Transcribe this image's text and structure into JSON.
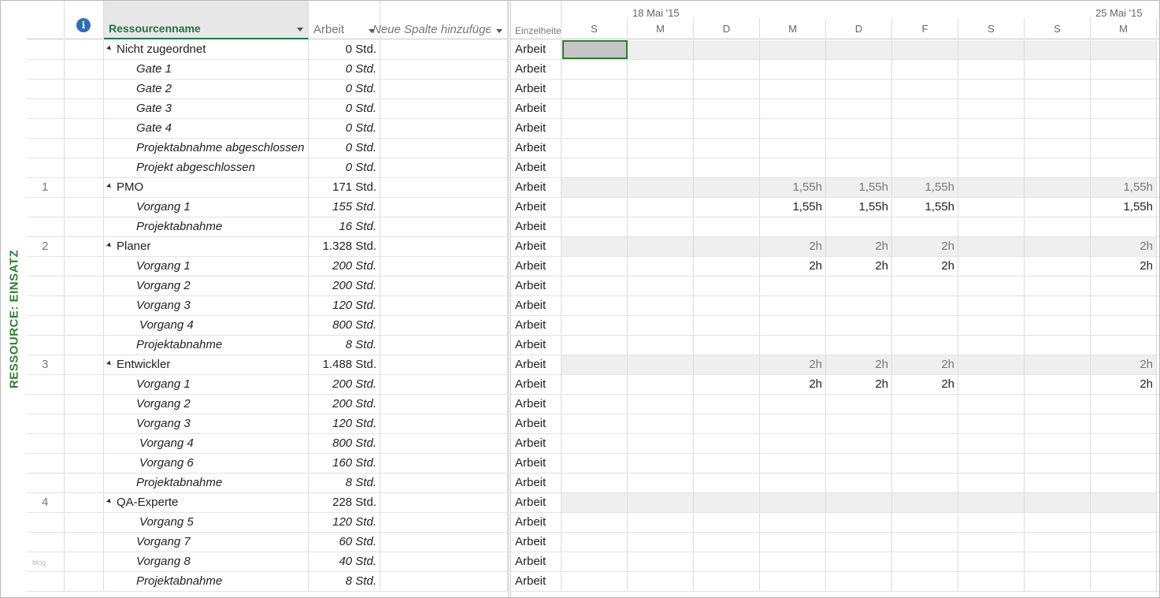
{
  "view_label": "RESSOURCE: EINSATZ",
  "columns": {
    "resource_name": "Ressourcenname",
    "work": "Arbeit",
    "add_column": "Neue Spalte hinzufügen",
    "details": "Einzelheiten"
  },
  "timescale": {
    "weeks": [
      {
        "label": "18 Mai '15"
      },
      {
        "label": "25 Mai '15"
      }
    ],
    "days": [
      "S",
      "M",
      "D",
      "M",
      "D",
      "F",
      "S",
      "S",
      "M"
    ]
  },
  "rows": [
    {
      "id": "",
      "name": "Nicht zugeordnet",
      "work": "0 Std.",
      "type": "parent",
      "detail": "Arbeit",
      "values": [
        "",
        "",
        "",
        "",
        "",
        "",
        "",
        "",
        ""
      ]
    },
    {
      "id": "",
      "name": "Gate 1",
      "work": "0 Std.",
      "type": "child",
      "detail": "Arbeit",
      "values": [
        "",
        "",
        "",
        "",
        "",
        "",
        "",
        "",
        ""
      ]
    },
    {
      "id": "",
      "name": "Gate 2",
      "work": "0 Std.",
      "type": "child",
      "detail": "Arbeit",
      "values": [
        "",
        "",
        "",
        "",
        "",
        "",
        "",
        "",
        ""
      ]
    },
    {
      "id": "",
      "name": "Gate 3",
      "work": "0 Std.",
      "type": "child",
      "detail": "Arbeit",
      "values": [
        "",
        "",
        "",
        "",
        "",
        "",
        "",
        "",
        ""
      ]
    },
    {
      "id": "",
      "name": "Gate 4",
      "work": "0 Std.",
      "type": "child",
      "detail": "Arbeit",
      "values": [
        "",
        "",
        "",
        "",
        "",
        "",
        "",
        "",
        ""
      ]
    },
    {
      "id": "",
      "name": "Projektabnahme abgeschlossen",
      "work": "0 Std.",
      "type": "child",
      "detail": "Arbeit",
      "values": [
        "",
        "",
        "",
        "",
        "",
        "",
        "",
        "",
        ""
      ]
    },
    {
      "id": "",
      "name": "Projekt abgeschlossen",
      "work": "0 Std.",
      "type": "child",
      "detail": "Arbeit",
      "values": [
        "",
        "",
        "",
        "",
        "",
        "",
        "",
        "",
        ""
      ]
    },
    {
      "id": "1",
      "name": "PMO",
      "work": "171 Std.",
      "type": "parent",
      "detail": "Arbeit",
      "values": [
        "",
        "",
        "",
        "1,55h",
        "1,55h",
        "1,55h",
        "",
        "",
        "1,55h"
      ]
    },
    {
      "id": "",
      "name": "Vorgang 1",
      "work": "155 Std.",
      "type": "child",
      "detail": "Arbeit",
      "values": [
        "",
        "",
        "",
        "1,55h",
        "1,55h",
        "1,55h",
        "",
        "",
        "1,55h"
      ]
    },
    {
      "id": "",
      "name": "Projektabnahme",
      "work": "16 Std.",
      "type": "child",
      "detail": "Arbeit",
      "values": [
        "",
        "",
        "",
        "",
        "",
        "",
        "",
        "",
        ""
      ]
    },
    {
      "id": "2",
      "name": "Planer",
      "work": "1.328 Std.",
      "type": "parent",
      "detail": "Arbeit",
      "values": [
        "",
        "",
        "",
        "2h",
        "2h",
        "2h",
        "",
        "",
        "2h"
      ]
    },
    {
      "id": "",
      "name": "Vorgang 1",
      "work": "200 Std.",
      "type": "child",
      "detail": "Arbeit",
      "values": [
        "",
        "",
        "",
        "2h",
        "2h",
        "2h",
        "",
        "",
        "2h"
      ]
    },
    {
      "id": "",
      "name": "Vorgang 2",
      "work": "200 Std.",
      "type": "child",
      "detail": "Arbeit",
      "values": [
        "",
        "",
        "",
        "",
        "",
        "",
        "",
        "",
        ""
      ]
    },
    {
      "id": "",
      "name": "Vorgang 3",
      "work": "120 Std.",
      "type": "child",
      "detail": "Arbeit",
      "values": [
        "",
        "",
        "",
        "",
        "",
        "",
        "",
        "",
        ""
      ]
    },
    {
      "id": "",
      "name": "Vorgang 4",
      "work": "800 Std.",
      "type": "child",
      "extra_indent": true,
      "detail": "Arbeit",
      "values": [
        "",
        "",
        "",
        "",
        "",
        "",
        "",
        "",
        ""
      ]
    },
    {
      "id": "",
      "name": "Projektabnahme",
      "work": "8 Std.",
      "type": "child",
      "detail": "Arbeit",
      "values": [
        "",
        "",
        "",
        "",
        "",
        "",
        "",
        "",
        ""
      ]
    },
    {
      "id": "3",
      "name": "Entwickler",
      "work": "1.488 Std.",
      "type": "parent",
      "detail": "Arbeit",
      "values": [
        "",
        "",
        "",
        "2h",
        "2h",
        "2h",
        "",
        "",
        "2h"
      ]
    },
    {
      "id": "",
      "name": "Vorgang 1",
      "work": "200 Std.",
      "type": "child",
      "detail": "Arbeit",
      "values": [
        "",
        "",
        "",
        "2h",
        "2h",
        "2h",
        "",
        "",
        "2h"
      ]
    },
    {
      "id": "",
      "name": "Vorgang 2",
      "work": "200 Std.",
      "type": "child",
      "detail": "Arbeit",
      "values": [
        "",
        "",
        "",
        "",
        "",
        "",
        "",
        "",
        ""
      ]
    },
    {
      "id": "",
      "name": "Vorgang 3",
      "work": "120 Std.",
      "type": "child",
      "detail": "Arbeit",
      "values": [
        "",
        "",
        "",
        "",
        "",
        "",
        "",
        "",
        ""
      ]
    },
    {
      "id": "",
      "name": "Vorgang 4",
      "work": "800 Std.",
      "type": "child",
      "extra_indent": true,
      "detail": "Arbeit",
      "values": [
        "",
        "",
        "",
        "",
        "",
        "",
        "",
        "",
        ""
      ]
    },
    {
      "id": "",
      "name": "Vorgang 6",
      "work": "160 Std.",
      "type": "child",
      "extra_indent": true,
      "detail": "Arbeit",
      "values": [
        "",
        "",
        "",
        "",
        "",
        "",
        "",
        "",
        ""
      ]
    },
    {
      "id": "",
      "name": "Projektabnahme",
      "work": "8 Std.",
      "type": "child",
      "detail": "Arbeit",
      "values": [
        "",
        "",
        "",
        "",
        "",
        "",
        "",
        "",
        ""
      ]
    },
    {
      "id": "4",
      "name": "QA-Experte",
      "work": "228 Std.",
      "type": "parent",
      "detail": "Arbeit",
      "values": [
        "",
        "",
        "",
        "",
        "",
        "",
        "",
        "",
        ""
      ]
    },
    {
      "id": "",
      "name": "Vorgang 5",
      "work": "120 Std.",
      "type": "child",
      "extra_indent": true,
      "detail": "Arbeit",
      "values": [
        "",
        "",
        "",
        "",
        "",
        "",
        "",
        "",
        ""
      ]
    },
    {
      "id": "",
      "name": "Vorgang 7",
      "work": "60 Std.",
      "type": "child",
      "detail": "Arbeit",
      "values": [
        "",
        "",
        "",
        "",
        "",
        "",
        "",
        "",
        ""
      ]
    },
    {
      "id": "",
      "name": "Vorgang 8",
      "work": "40 Std.",
      "type": "child",
      "detail": "Arbeit",
      "values": [
        "",
        "",
        "",
        "",
        "",
        "",
        "",
        "",
        ""
      ]
    },
    {
      "id": "",
      "name": "Projektabnahme",
      "work": "8 Std.",
      "type": "child",
      "detail": "Arbeit",
      "values": [
        "",
        "",
        "",
        "",
        "",
        "",
        "",
        "",
        ""
      ]
    }
  ],
  "watermark": "blog",
  "colors": {
    "accent": "#217346",
    "selection": "#c5c5c5",
    "parent_timephased_bg": "#efefef"
  }
}
